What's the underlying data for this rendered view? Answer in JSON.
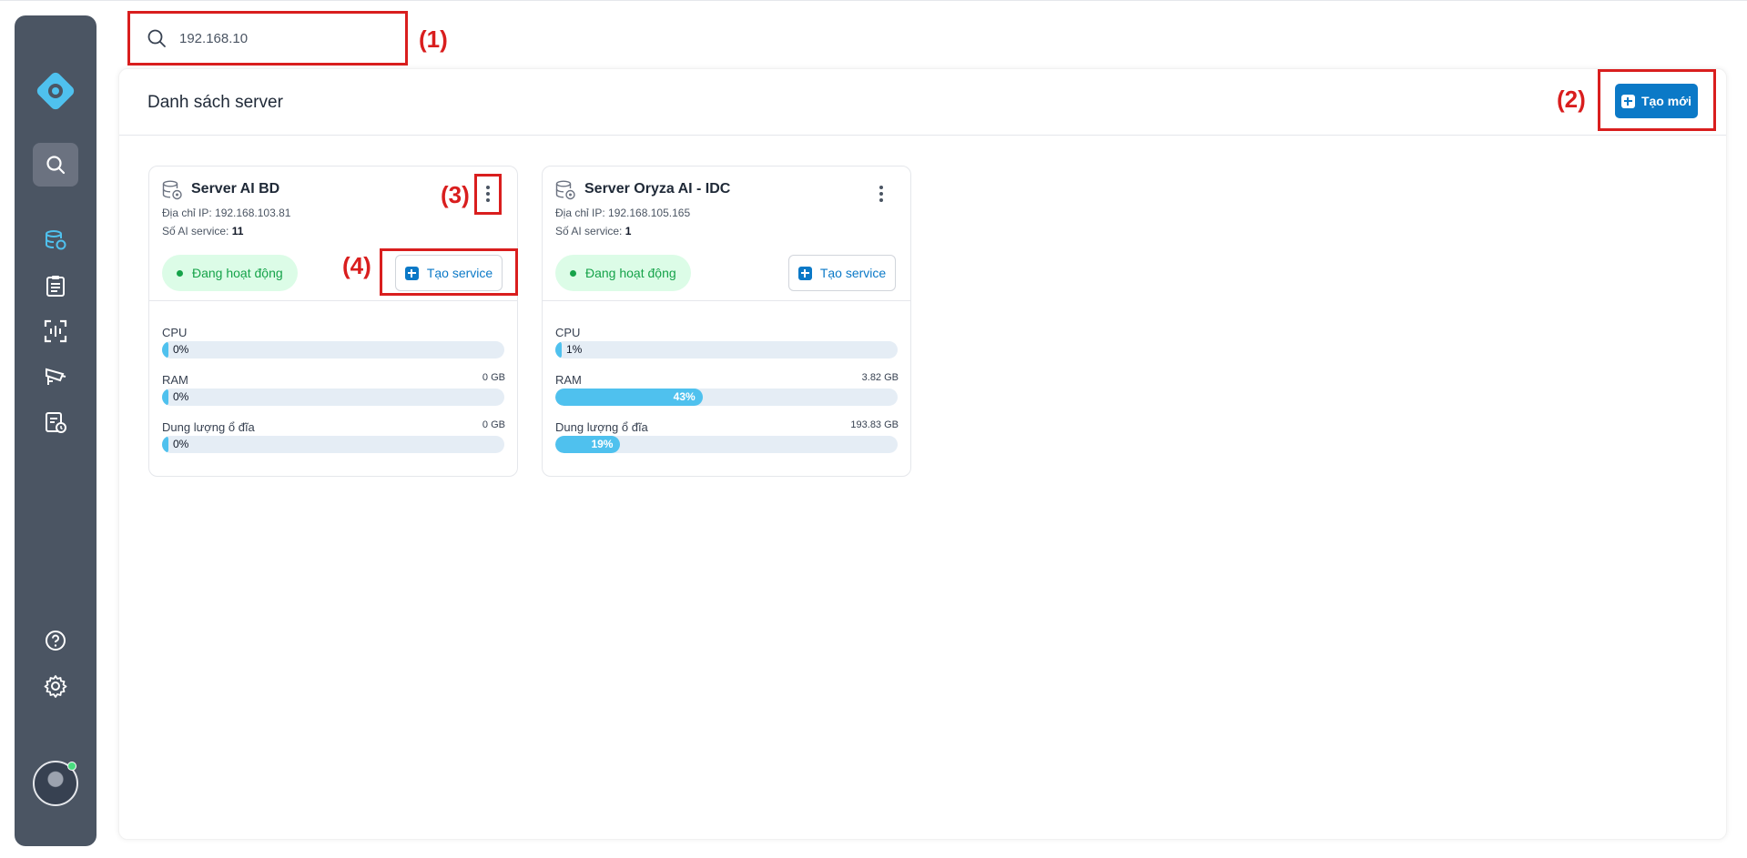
{
  "search": {
    "value": "192.168.10"
  },
  "annotations": {
    "a1": "(1)",
    "a2": "(2)",
    "a3": "(3)",
    "a4": "(4)"
  },
  "sidebar": {
    "icons": [
      "logo-icon",
      "search-icon",
      "database-server-icon",
      "clipboard-icon",
      "scan-icon",
      "camera-icon",
      "report-schedule-icon",
      "help-icon",
      "settings-icon",
      "avatar"
    ]
  },
  "header": {
    "title": "Danh sách server",
    "create_label": "Tạo mới"
  },
  "labels": {
    "ip_prefix": "Địa chỉ IP:",
    "service_prefix": "Số AI service:",
    "create_service": "Tạo service",
    "cpu": "CPU",
    "ram": "RAM",
    "disk": "Dung lượng ổ đĩa"
  },
  "servers": [
    {
      "name": "Server AI BD",
      "ip": "192.168.103.81",
      "service_count": "11",
      "status": "Đang hoạt động",
      "cpu_pct": 0,
      "cpu_label": "0%",
      "ram_pct": 0,
      "ram_label": "0%",
      "ram_total": "0 GB",
      "disk_pct": 0,
      "disk_label": "0%",
      "disk_total": "0 GB"
    },
    {
      "name": "Server Oryza AI - IDC",
      "ip": "192.168.105.165",
      "service_count": "1",
      "status": "Đang hoạt động",
      "cpu_pct": 1,
      "cpu_label": "1%",
      "ram_pct": 43,
      "ram_label": "43%",
      "ram_total": "3.82 GB",
      "disk_pct": 19,
      "disk_label": "19%",
      "disk_total": "193.83 GB"
    }
  ],
  "colors": {
    "accent": "#0b79c7",
    "status_green": "#16a34a",
    "bar": "#4fc1ee",
    "annotation": "#d91e1e",
    "sidebar": "#4b5563"
  }
}
